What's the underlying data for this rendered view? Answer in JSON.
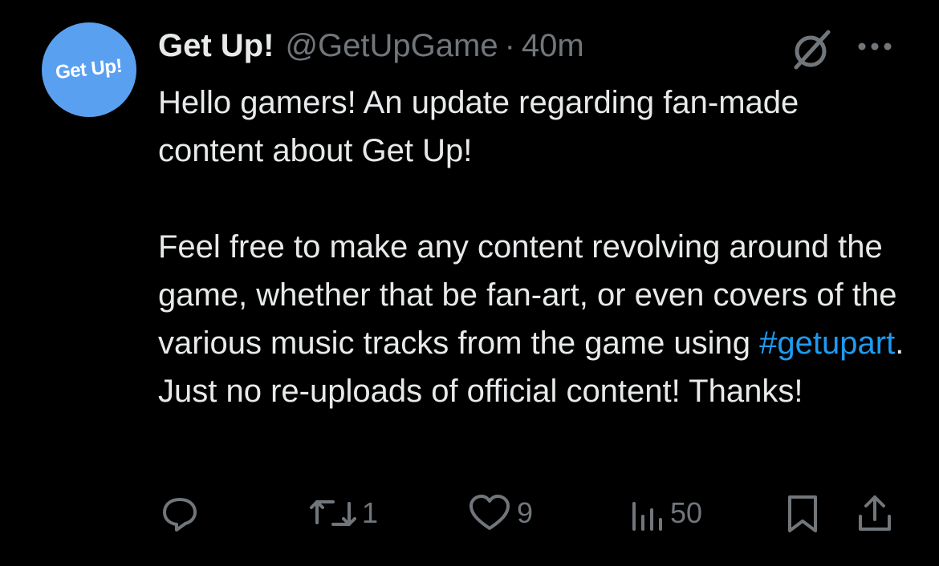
{
  "post": {
    "avatar_text": "Get Up!",
    "display_name": "Get Up!",
    "handle": "@GetUpGame",
    "separator": "·",
    "time": "40m",
    "body": {
      "paragraph1": "Hello gamers! An update regarding fan-made content about Get Up!",
      "paragraph2_before": "Feel free to make any content revolving around the game, whether that be fan-art, or even covers of the various music tracks from the game using ",
      "hashtag": "#getupart",
      "paragraph2_after": ". Just no re-uploads of official content! Thanks!"
    }
  },
  "actions": {
    "reply_icon": "reply-icon",
    "repost_icon": "repost-icon",
    "repost_count": "1",
    "like_icon": "heart-icon",
    "like_count": "9",
    "views_icon": "views-icon",
    "views_count": "50",
    "bookmark_icon": "bookmark-icon",
    "share_icon": "share-icon"
  },
  "colors": {
    "background": "#000000",
    "text": "#e7e9ea",
    "secondary": "#71767b",
    "link": "#1d9bf0",
    "avatar": "#5aa0f0"
  }
}
